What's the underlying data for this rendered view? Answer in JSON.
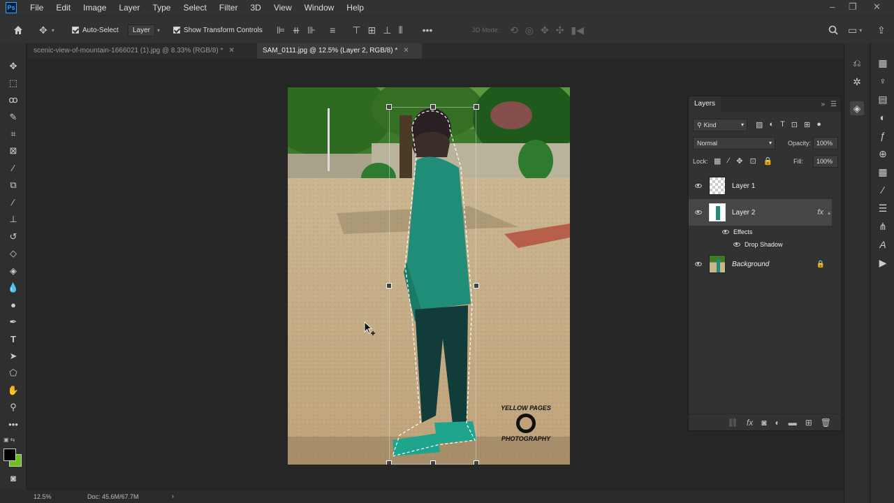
{
  "menu": [
    "File",
    "Edit",
    "Image",
    "Layer",
    "Type",
    "Select",
    "Filter",
    "3D",
    "View",
    "Window",
    "Help"
  ],
  "app_logo": "Ps",
  "options": {
    "auto_select_label": "Auto-Select",
    "auto_select_target": "Layer",
    "show_transform_label": "Show Transform Controls",
    "mode_3d_label": "3D Mode:"
  },
  "tabs": [
    {
      "label": "scenic-view-of-mountain-1666021 (1).jpg @ 8.33% (RGB/8) *",
      "active": false
    },
    {
      "label": "SAM_0111.jpg @ 12.5% (Layer 2, RGB/8) *",
      "active": true
    }
  ],
  "layers_panel": {
    "title": "Layers",
    "filter_kind": "Kind",
    "blend_mode": "Normal",
    "opacity_label": "Opacity:",
    "opacity": "100%",
    "lock_label": "Lock:",
    "fill_label": "Fill:",
    "fill": "100%",
    "layers": [
      {
        "name": "Layer 1"
      },
      {
        "name": "Layer 2",
        "fx": "fx",
        "selected": true
      },
      {
        "name": "Background",
        "locked": true
      }
    ],
    "effects_label": "Effects",
    "effect_item": "Drop Shadow"
  },
  "watermark": {
    "line1": "YELLOW PAGES",
    "line2": "PHOTOGRAPHY"
  },
  "status": {
    "zoom": "12.5%",
    "doc": "Doc: 45.6M/67.7M"
  },
  "colors": {
    "accent": "#31a8ff",
    "foreground": "#000000",
    "background": "#6fbf1c"
  }
}
